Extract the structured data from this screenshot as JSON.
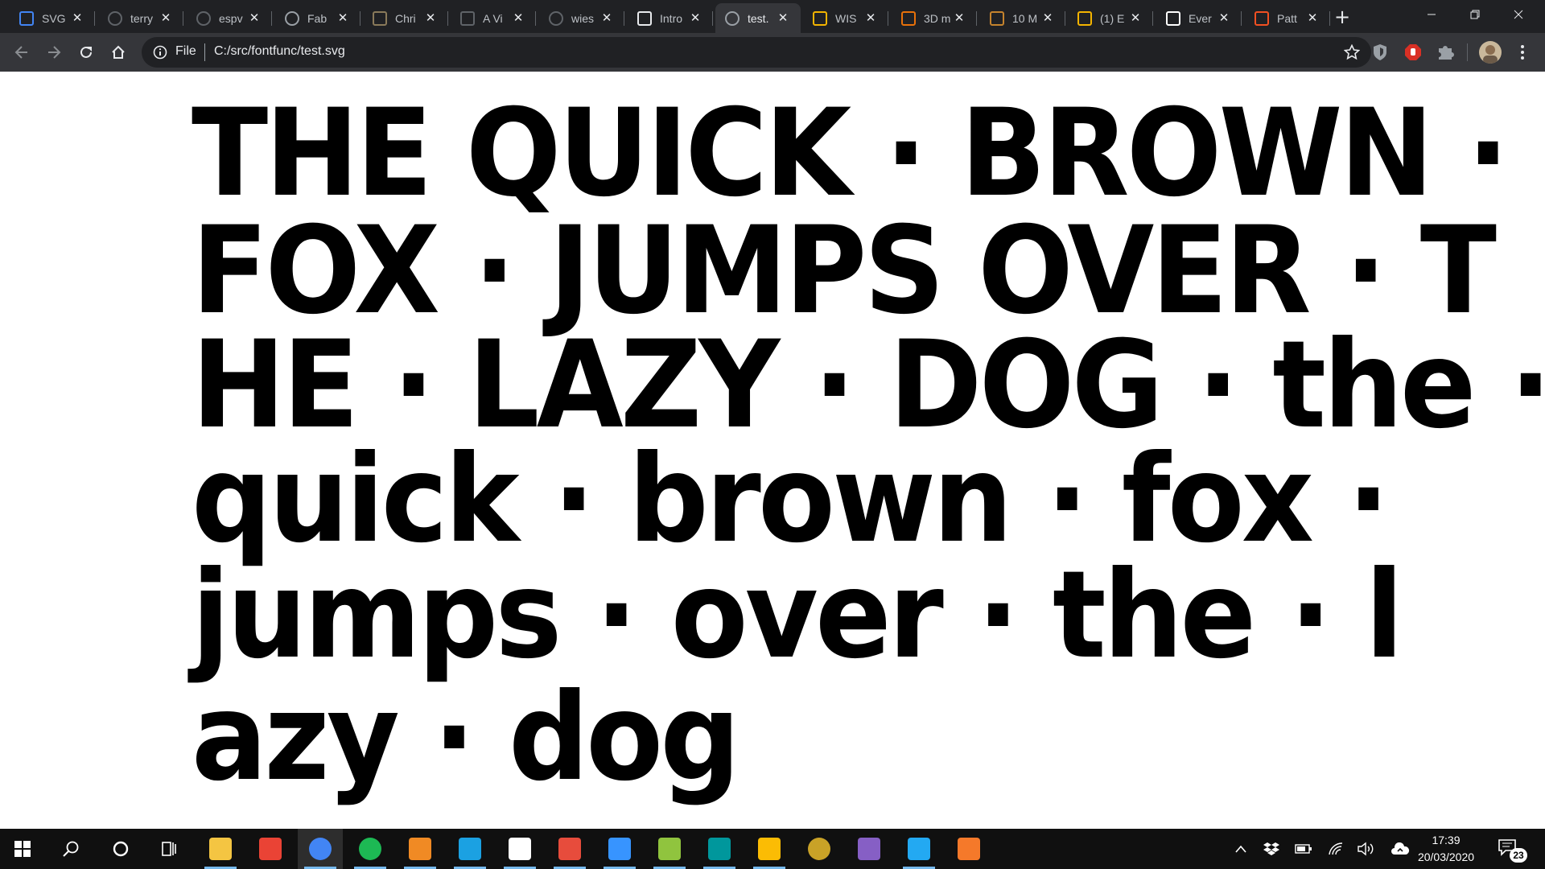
{
  "browser": {
    "tabs": [
      {
        "title": "SVG",
        "favicon": "svg-favicon",
        "favicon_color": "#4285f4",
        "active": false
      },
      {
        "title": "terry",
        "favicon": "github-favicon",
        "favicon_color": "#5f6368",
        "active": false
      },
      {
        "title": "espv",
        "favicon": "github-favicon",
        "favicon_color": "#5f6368",
        "active": false
      },
      {
        "title": "Fab",
        "favicon": "globe-favicon",
        "favicon_color": "#9aa0a6",
        "active": false
      },
      {
        "title": "Chri",
        "favicon": "image-favicon",
        "favicon_color": "#8a7a5a",
        "active": false
      },
      {
        "title": "A Vi",
        "favicon": "triangle-favicon",
        "favicon_color": "#5f6368",
        "active": false
      },
      {
        "title": "wies",
        "favicon": "github-favicon",
        "favicon_color": "#5f6368",
        "active": false
      },
      {
        "title": "Intro",
        "favicon": "graduation-cap-favicon",
        "favicon_color": "#e8eaed",
        "active": false
      },
      {
        "title": "test.",
        "favicon": "globe-favicon",
        "favicon_color": "#9aa0a6",
        "active": true
      },
      {
        "title": "WIS",
        "favicon": "g-favicon",
        "favicon_color": "#f4b400",
        "active": false
      },
      {
        "title": "3D m",
        "favicon": "pinwheel-favicon",
        "favicon_color": "#e8710a",
        "active": false
      },
      {
        "title": "10 M",
        "favicon": "sr-favicon",
        "favicon_color": "#c5832d",
        "active": false
      },
      {
        "title": "(1) E",
        "favicon": "g-favicon",
        "favicon_color": "#f4b400",
        "active": false
      },
      {
        "title": "Ever",
        "favicon": "wikipedia-favicon",
        "favicon_color": "#ffffff",
        "active": false
      },
      {
        "title": "Patt",
        "favicon": "microsoft-favicon",
        "favicon_color": "#f25022",
        "active": false
      }
    ],
    "new_tab_label": "+",
    "address": {
      "scheme_label": "File",
      "url": "C:/src/fontfunc/test.svg"
    }
  },
  "content": {
    "lines": [
      "THE QUICK · BROWN ·",
      "FOX · JUMPS OVER · T",
      "HE · LAZY · DOG · the ·",
      "quick · brown · fox ·",
      "jumps · over · the · l",
      "azy · dog"
    ]
  },
  "taskbar": {
    "apps": [
      {
        "name": "file-explorer",
        "icon_color": "#f4c542"
      },
      {
        "name": "gmail",
        "icon_color": "#ea4335"
      },
      {
        "name": "chrome",
        "icon_color": "#4285f4"
      },
      {
        "name": "spotify",
        "icon_color": "#1db954"
      },
      {
        "name": "fontforge",
        "icon_color": "#f08a24"
      },
      {
        "name": "ccleaner",
        "icon_color": "#1ba1e2"
      },
      {
        "name": "notepad",
        "icon_color": "#ffffff"
      },
      {
        "name": "xmind",
        "icon_color": "#e74c3c"
      },
      {
        "name": "terminal",
        "icon_color": "#3794ff"
      },
      {
        "name": "notepad-plus-plus",
        "icon_color": "#90c43e"
      },
      {
        "name": "arduino",
        "icon_color": "#00979c"
      },
      {
        "name": "keep",
        "icon_color": "#fbbc04"
      },
      {
        "name": "globe-app",
        "icon_color": "#c9a227"
      },
      {
        "name": "visual-studio",
        "icon_color": "#865fc5"
      },
      {
        "name": "vscode",
        "icon_color": "#23a9f2"
      },
      {
        "name": "blender",
        "icon_color": "#f5792a"
      }
    ],
    "clock_time": "17:39",
    "clock_date": "20/03/2020",
    "notification_count": "23"
  }
}
